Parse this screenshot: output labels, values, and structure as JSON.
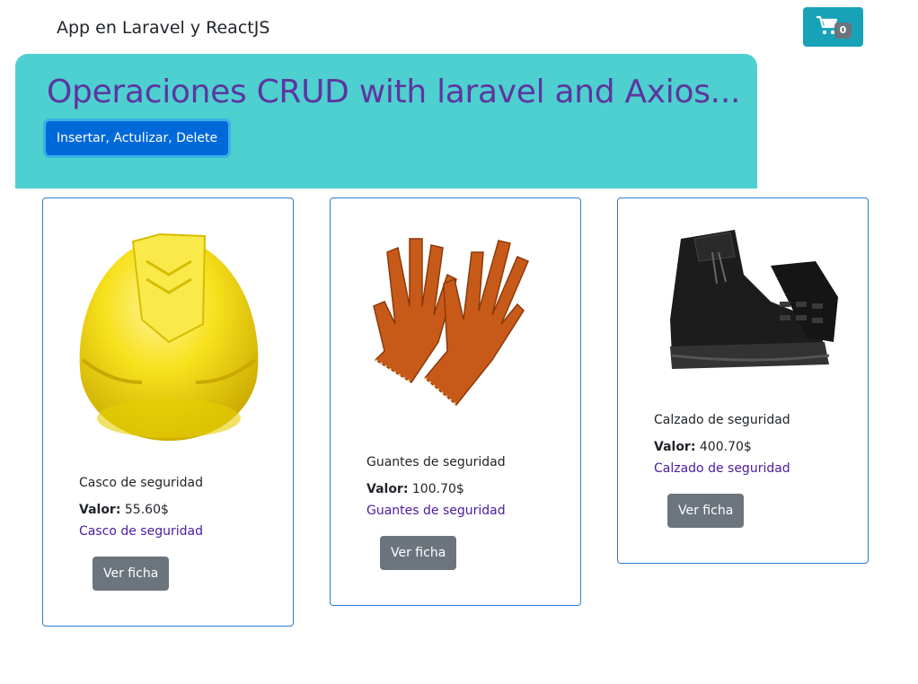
{
  "navbar": {
    "brand": "App en Laravel y ReactJS",
    "cart_count": "0"
  },
  "jumbotron": {
    "title": "Operaciones CRUD with laravel and Axios...",
    "button_label": "Insertar, Actulizar, Delete"
  },
  "products": [
    {
      "name": "Casco de seguridad",
      "price_label": "Valor:",
      "price": "55.60$",
      "link": "Casco de seguridad",
      "button": "Ver ficha",
      "image_icon": "hard-hat"
    },
    {
      "name": "Guantes de seguridad",
      "price_label": "Valor:",
      "price": "100.70$",
      "link": "Guantes de seguridad",
      "button": "Ver ficha",
      "image_icon": "work-gloves"
    },
    {
      "name": "Calzado de seguridad",
      "price_label": "Valor:",
      "price": "400.70$",
      "link": "Calzado de seguridad",
      "button": "Ver ficha",
      "image_icon": "safety-boots"
    }
  ],
  "colors": {
    "cart_button": "#17a2b8",
    "jumbotron_bg": "#4dd0cf",
    "title": "#5e35a0",
    "primary": "#0069d9",
    "secondary": "#6c757d",
    "card_border": "#2f7ad6",
    "link": "#4b1aa0"
  }
}
